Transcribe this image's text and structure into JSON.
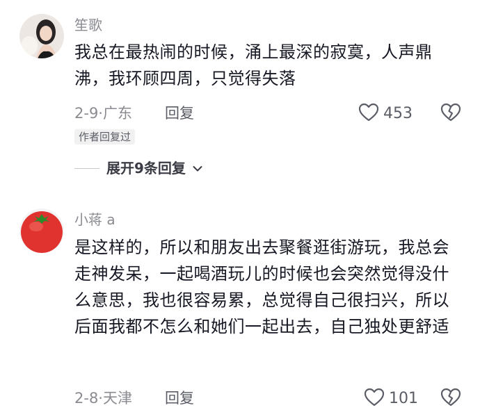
{
  "comments": [
    {
      "username": "笙歌",
      "text": "我总在最热闹的时候，涌上最深的寂寞，人声鼎沸，我环顾四周，只觉得失落",
      "meta": "2-9·广东",
      "reply_label": "回复",
      "like_count": "453",
      "badge": "作者回复过",
      "expand_label": "展开9条回复"
    },
    {
      "username": "小蒋 a",
      "text": "是这样的，所以和朋友出去聚餐逛街游玩，我总会走神发呆，一起喝酒玩儿的时候也会突然觉得没什么意思，我也很容易累，总觉得自己很扫兴，所以后面我都不怎么和她们一起出去，自己独处更舒适",
      "meta": "2-8·天津",
      "reply_label": "回复",
      "like_count": "101"
    }
  ],
  "icons": {
    "like": "heart-outline-icon",
    "dislike": "broken-heart-icon",
    "expand": "chevron-down-icon"
  },
  "colors": {
    "text": "#161823",
    "secondary": "#8a8b91",
    "badge_bg": "#f1f1f2"
  }
}
